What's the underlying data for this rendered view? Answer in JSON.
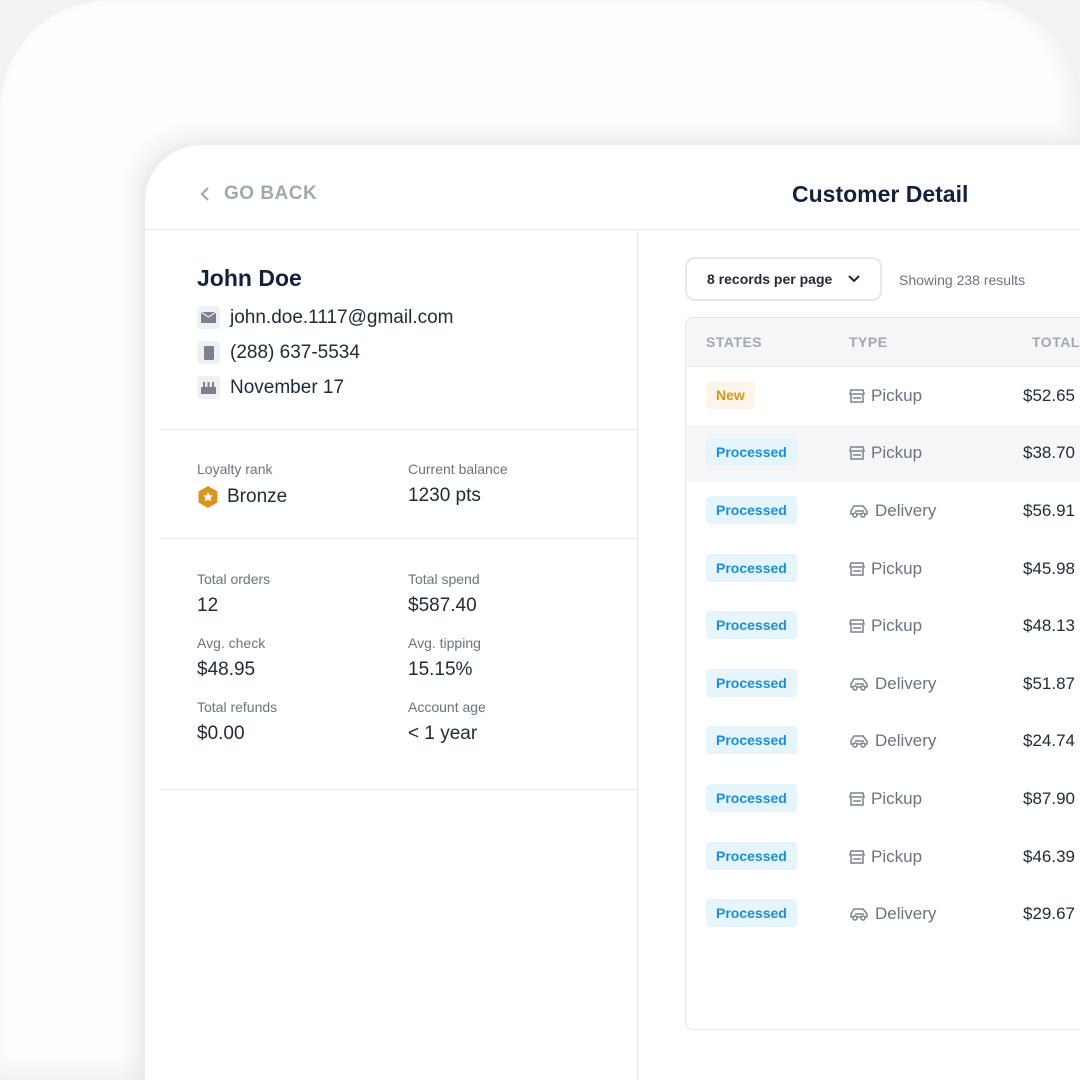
{
  "header": {
    "back_label": "GO BACK",
    "title": "Customer Detail"
  },
  "customer": {
    "name": "John Doe",
    "email": "john.doe.1117@gmail.com",
    "phone": "(288) 637-5534",
    "birthday": "November 17"
  },
  "loyalty": {
    "rank_label": "Loyalty rank",
    "rank": "Bronze",
    "balance_label": "Current balance",
    "balance": "1230 pts"
  },
  "stats": [
    {
      "label": "Total orders",
      "value": "12"
    },
    {
      "label": "Total spend",
      "value": "$587.40"
    },
    {
      "label": "Avg. check",
      "value": "$48.95"
    },
    {
      "label": "Avg. tipping",
      "value": "15.15%"
    },
    {
      "label": "Total refunds",
      "value": "$0.00"
    },
    {
      "label": "Account age",
      "value": "< 1 year"
    }
  ],
  "records": {
    "per_page": "8 records per page",
    "count": "Showing 238 results"
  },
  "table": {
    "columns": [
      "STATES",
      "TYPE",
      "TOTAL"
    ],
    "rows": [
      {
        "state": "New",
        "type": "Pickup",
        "total": "$52.65"
      },
      {
        "state": "Processed",
        "type": "Pickup",
        "total": "$38.70"
      },
      {
        "state": "Processed",
        "type": "Delivery",
        "total": "$56.91"
      },
      {
        "state": "Processed",
        "type": "Pickup",
        "total": "$45.98"
      },
      {
        "state": "Processed",
        "type": "Pickup",
        "total": "$48.13"
      },
      {
        "state": "Processed",
        "type": "Delivery",
        "total": "$51.87"
      },
      {
        "state": "Processed",
        "type": "Delivery",
        "total": "$24.74"
      },
      {
        "state": "Processed",
        "type": "Pickup",
        "total": "$87.90"
      },
      {
        "state": "Processed",
        "type": "Pickup",
        "total": "$46.39"
      },
      {
        "state": "Processed",
        "type": "Delivery",
        "total": "$29.67"
      }
    ]
  },
  "colors": {
    "new": "#d9951f",
    "processed": "#1a8fd6",
    "bronze": "#d9951f"
  }
}
